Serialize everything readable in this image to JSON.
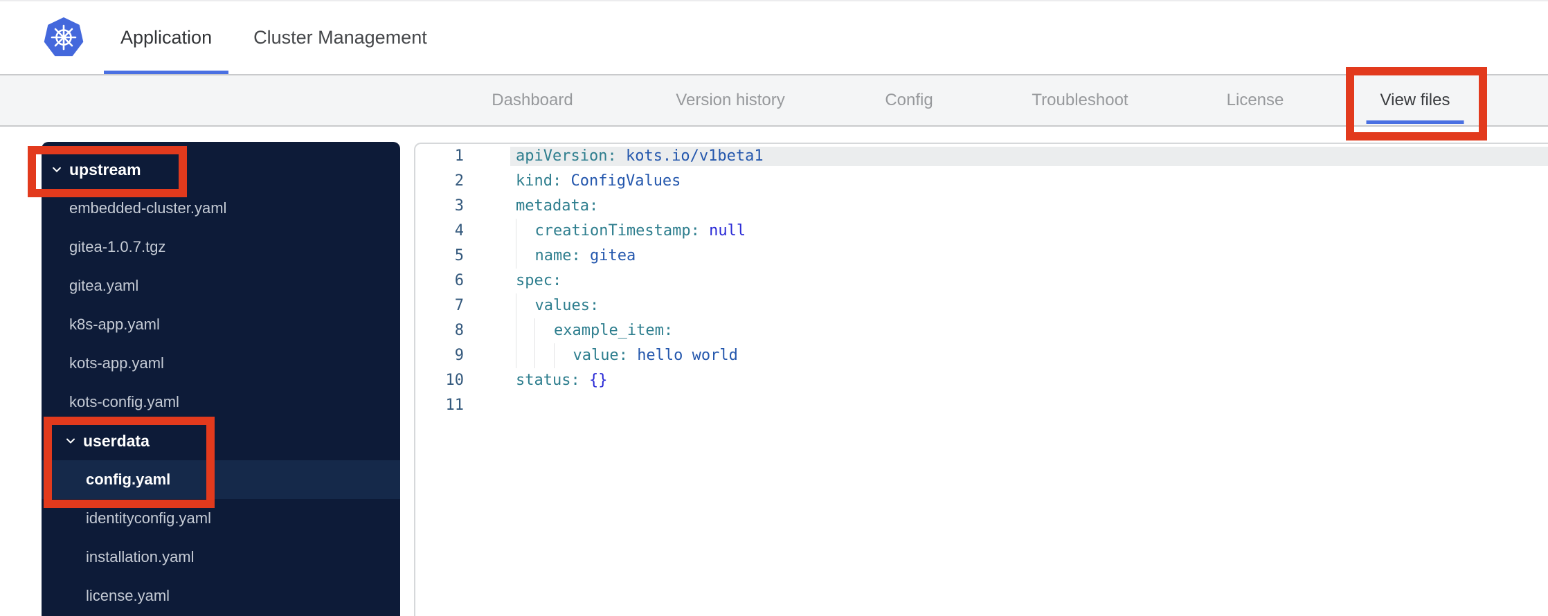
{
  "header": {
    "logo": "kubernetes-logo",
    "tabs": [
      {
        "key": "application",
        "label": "Application",
        "active": true
      },
      {
        "key": "cluster-management",
        "label": "Cluster Management",
        "active": false
      }
    ]
  },
  "subnav": {
    "tabs": [
      {
        "key": "dashboard",
        "label": "Dashboard",
        "active": false
      },
      {
        "key": "version-history",
        "label": "Version history",
        "active": false
      },
      {
        "key": "config",
        "label": "Config",
        "active": false
      },
      {
        "key": "troubleshoot",
        "label": "Troubleshoot",
        "active": false
      },
      {
        "key": "license",
        "label": "License",
        "active": false
      },
      {
        "key": "view-files",
        "label": "View files",
        "active": true
      }
    ]
  },
  "file_tree": {
    "items": [
      {
        "type": "folder",
        "label": "upstream",
        "level": 0,
        "expanded": true
      },
      {
        "type": "file",
        "label": "embedded-cluster.yaml",
        "level": 1
      },
      {
        "type": "file",
        "label": "gitea-1.0.7.tgz",
        "level": 1
      },
      {
        "type": "file",
        "label": "gitea.yaml",
        "level": 1
      },
      {
        "type": "file",
        "label": "k8s-app.yaml",
        "level": 1
      },
      {
        "type": "file",
        "label": "kots-app.yaml",
        "level": 1
      },
      {
        "type": "file",
        "label": "kots-config.yaml",
        "level": 1
      },
      {
        "type": "folder",
        "label": "userdata",
        "level": 1,
        "expanded": true
      },
      {
        "type": "file",
        "label": "config.yaml",
        "level": 2,
        "selected": true
      },
      {
        "type": "file",
        "label": "identityconfig.yaml",
        "level": 2
      },
      {
        "type": "file",
        "label": "installation.yaml",
        "level": 2
      },
      {
        "type": "file",
        "label": "license.yaml",
        "level": 2
      }
    ]
  },
  "editor": {
    "filename": "config.yaml",
    "lines": [
      {
        "num": 1,
        "indent": 0,
        "key": "apiVersion",
        "value": "kots.io/v1beta1",
        "vtype": "plain",
        "selected": true
      },
      {
        "num": 2,
        "indent": 0,
        "key": "kind",
        "value": "ConfigValues",
        "vtype": "plain"
      },
      {
        "num": 3,
        "indent": 0,
        "key": "metadata",
        "value": null
      },
      {
        "num": 4,
        "indent": 2,
        "key": "creationTimestamp",
        "value": "null",
        "vtype": "keyword"
      },
      {
        "num": 5,
        "indent": 2,
        "key": "name",
        "value": "gitea",
        "vtype": "plain"
      },
      {
        "num": 6,
        "indent": 0,
        "key": "spec",
        "value": null
      },
      {
        "num": 7,
        "indent": 2,
        "key": "values",
        "value": null
      },
      {
        "num": 8,
        "indent": 4,
        "key": "example_item",
        "value": null
      },
      {
        "num": 9,
        "indent": 6,
        "key": "value",
        "value": "hello world",
        "vtype": "plain"
      },
      {
        "num": 10,
        "indent": 0,
        "key": "status",
        "value": "{}",
        "vtype": "keyword"
      },
      {
        "num": 11,
        "indent": 0,
        "key": null,
        "value": null
      }
    ]
  },
  "annotations": [
    {
      "key": "view-files-tab"
    },
    {
      "key": "upstream-folder"
    },
    {
      "key": "userdata-config"
    }
  ],
  "colors": {
    "accent_blue": "#4a70e2",
    "annotation_red": "#e23a1d",
    "sidebar_bg": "#0d1b38",
    "sidebar_selected_bg": "#15294a",
    "code_key": "#2e7e8e",
    "code_value": "#2457ad",
    "code_keyword": "#2a2ad6",
    "active_line_bg": "#ebedee",
    "logo_blue": "#4468dc"
  }
}
